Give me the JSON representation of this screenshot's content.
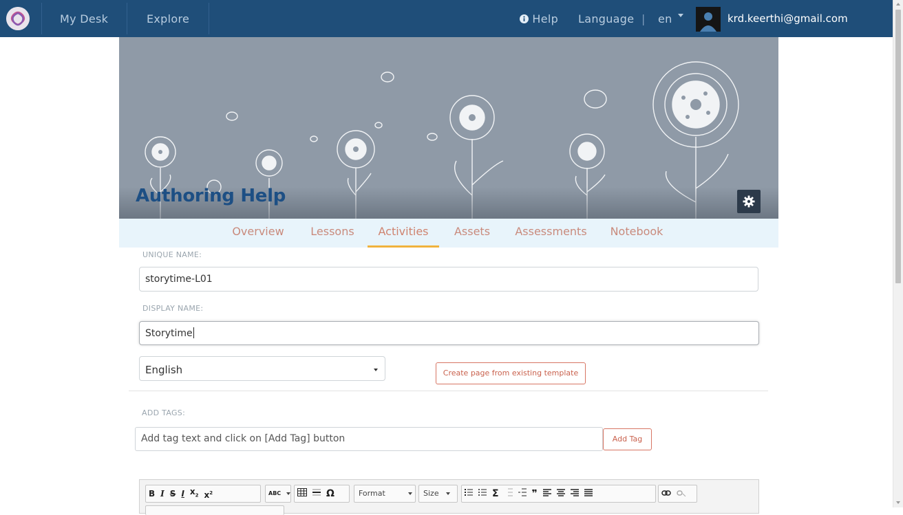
{
  "nav": {
    "my_desk": "My Desk",
    "explore": "Explore",
    "help": "Help",
    "language_label": "Language",
    "language_sep": "|",
    "language_code": "en",
    "user_email": "krd.keerthi@gmail.com"
  },
  "banner": {
    "title": "Authoring Help"
  },
  "tabs": [
    {
      "label": "Overview"
    },
    {
      "label": "Lessons"
    },
    {
      "label": "Activities"
    },
    {
      "label": "Assets"
    },
    {
      "label": "Assessments"
    },
    {
      "label": "Notebook"
    }
  ],
  "active_tab": "Activities",
  "form": {
    "unique_name_label": "UNIQUE NAME:",
    "unique_name_value": "storytime-L01",
    "display_name_label": "DISPLAY NAME:",
    "display_name_value": "Storytime",
    "language_value": "English",
    "template_button": "Create page from existing template",
    "add_tags_label": "ADD TAGS:",
    "tag_placeholder": "Add tag text and click on [Add Tag] button",
    "add_tag_button": "Add Tag"
  },
  "editor": {
    "format_label": "Format",
    "size_label": "Size",
    "omega": "Ω",
    "sigma": "Σ",
    "quote": "❞"
  },
  "colors": {
    "nav_bg": "#1f4e79",
    "banner_bg": "#8f9aa7",
    "title": "#1d4f84",
    "tab_text": "#c98a7c",
    "active_tab_underline": "#f0b23c",
    "button_border": "#d77563"
  }
}
